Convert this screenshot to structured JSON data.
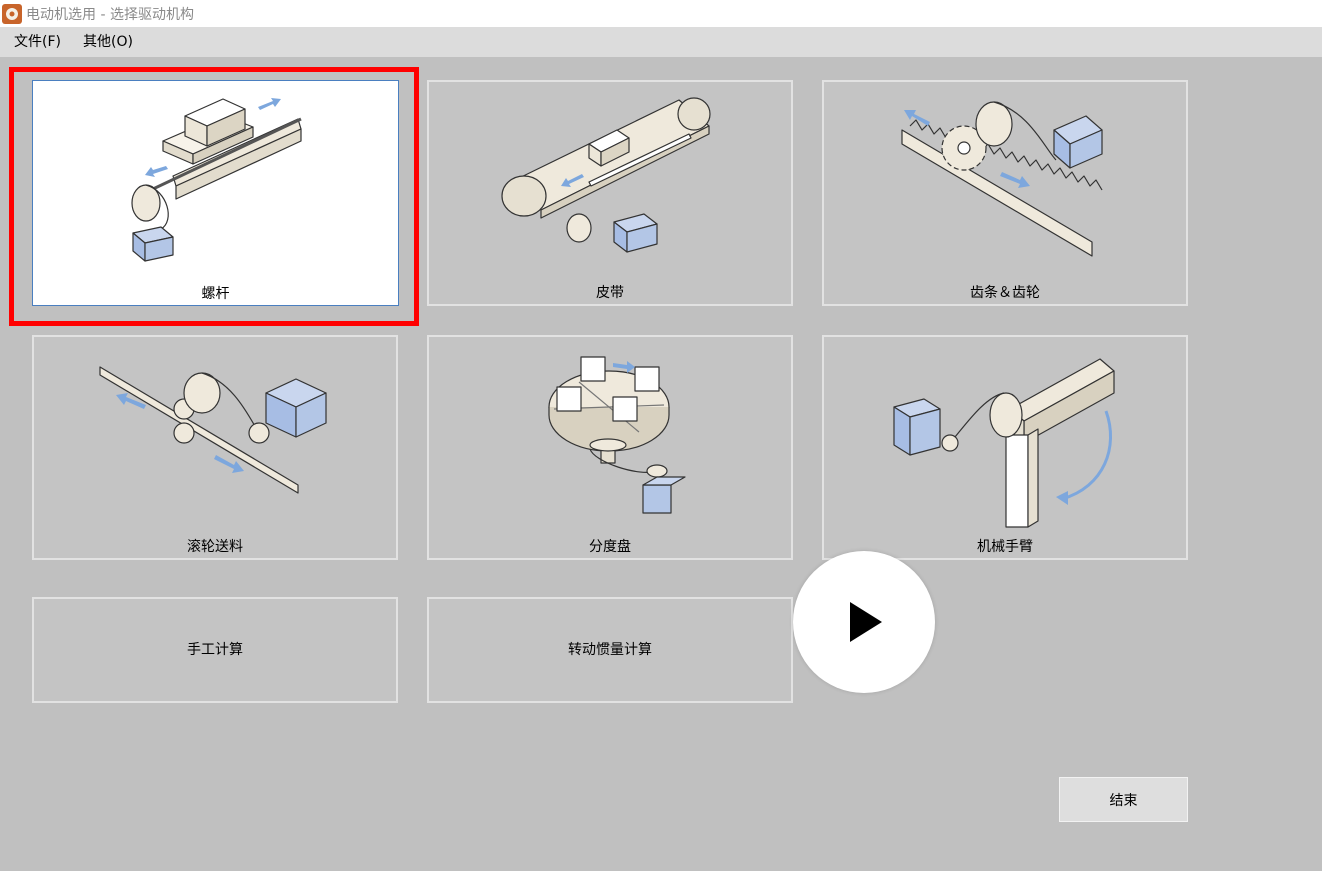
{
  "window": {
    "title": "电动机选用 - 选择驱动机构"
  },
  "menu": [
    {
      "label": "文件(F)"
    },
    {
      "label": "其他(O)"
    }
  ],
  "mechanisms": [
    {
      "label": "螺杆",
      "icon": "ball-screw-icon"
    },
    {
      "label": "皮带",
      "icon": "belt-conveyor-icon"
    },
    {
      "label": "齿条＆齿轮",
      "icon": "rack-pinion-icon"
    },
    {
      "label": "滚轮送料",
      "icon": "roller-feed-icon"
    },
    {
      "label": "分度盘",
      "icon": "index-table-icon"
    },
    {
      "label": "机械手臂",
      "icon": "robot-arm-icon"
    }
  ],
  "calculations": [
    {
      "label": "手工计算"
    },
    {
      "label": "转动惯量计算"
    }
  ],
  "end_button": {
    "label": "结束"
  },
  "colors": {
    "accent_blue": "#7da7dd",
    "selection_red": "#ff0000",
    "motor_blue": "#b3c6e6",
    "part_beige": "#efe9dc"
  }
}
